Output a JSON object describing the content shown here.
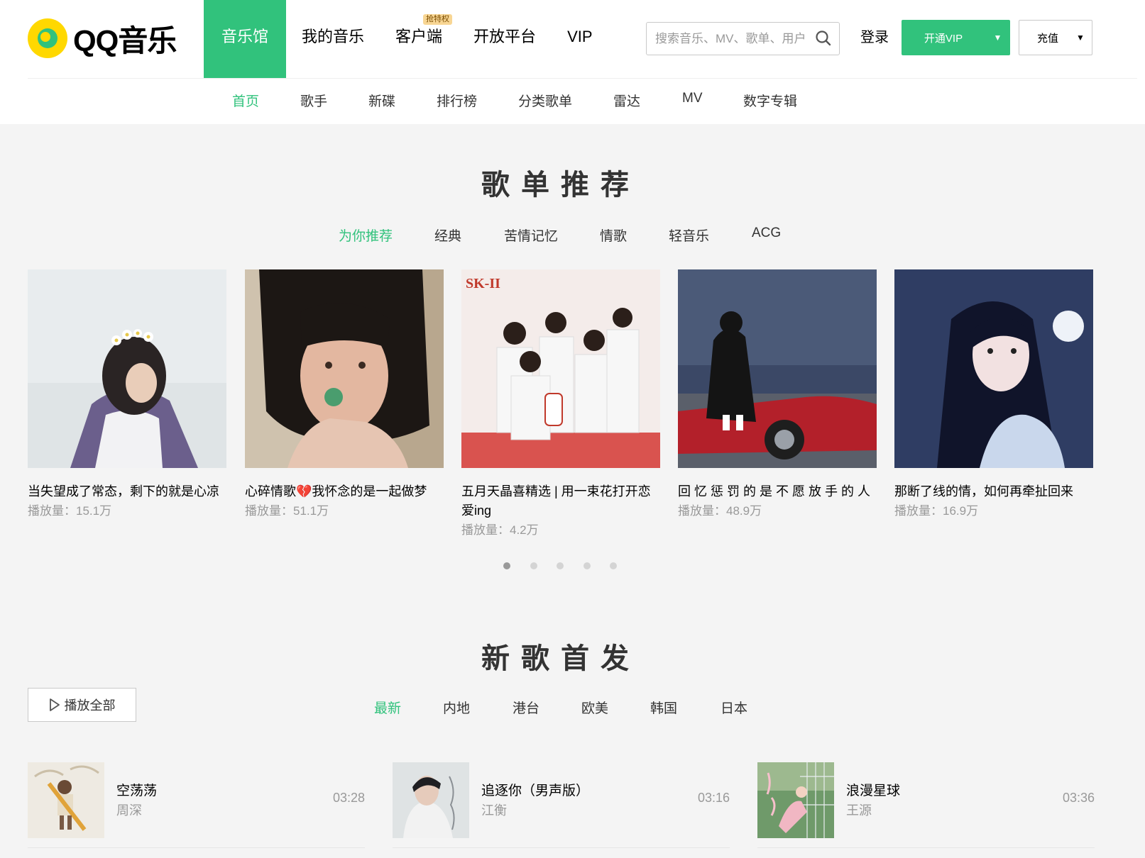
{
  "brand": {
    "logo_text": "QQ音乐",
    "accent_color": "#31c27c",
    "logo_color": "#ffd800"
  },
  "topnav": {
    "items": [
      {
        "label": "音乐馆",
        "active": true
      },
      {
        "label": "我的音乐"
      },
      {
        "label": "客户端",
        "badge": "抢特权"
      },
      {
        "label": "开放平台"
      },
      {
        "label": "VIP"
      }
    ]
  },
  "search": {
    "placeholder": "搜索音乐、MV、歌单、用户"
  },
  "account": {
    "login": "登录",
    "vip": "开通VIP",
    "recharge": "充值"
  },
  "subnav": {
    "items": [
      {
        "label": "首页",
        "active": true
      },
      {
        "label": "歌手"
      },
      {
        "label": "新碟"
      },
      {
        "label": "排行榜"
      },
      {
        "label": "分类歌单"
      },
      {
        "label": "雷达"
      },
      {
        "label": "MV"
      },
      {
        "label": "数字专辑"
      }
    ]
  },
  "playlists": {
    "title": "歌单推荐",
    "tabs": [
      {
        "label": "为你推荐",
        "active": true
      },
      {
        "label": "经典"
      },
      {
        "label": "苦情记忆"
      },
      {
        "label": "情歌"
      },
      {
        "label": "轻音乐"
      },
      {
        "label": "ACG"
      }
    ],
    "cards": [
      {
        "title": "当失望成了常态，剩下的就是心凉",
        "plays": "播放量：15.1万"
      },
      {
        "title": "心碎情歌💔我怀念的是一起做梦",
        "plays": "播放量：51.1万"
      },
      {
        "title": "五月天晶喜精选 | 用一束花打开恋爱ing",
        "plays": "播放量：4.2万"
      },
      {
        "title": "回 忆 惩 罚 的 是 不 愿 放 手 的 人",
        "plays": "播放量：48.9万"
      },
      {
        "title": "那断了线的情，如何再牵扯回来",
        "plays": "播放量：16.9万"
      }
    ],
    "pages": 5,
    "current_page": 1
  },
  "new_songs": {
    "title": "新歌首发",
    "play_all": "播放全部",
    "tabs": [
      {
        "label": "最新",
        "active": true
      },
      {
        "label": "内地"
      },
      {
        "label": "港台"
      },
      {
        "label": "欧美"
      },
      {
        "label": "韩国"
      },
      {
        "label": "日本"
      }
    ],
    "songs": [
      {
        "name": "空荡荡",
        "artist": "周深",
        "duration": "03:28"
      },
      {
        "name": "追逐你（男声版）",
        "artist": "江衡",
        "duration": "03:16"
      },
      {
        "name": "浪漫星球",
        "artist": "王源",
        "duration": "03:36"
      }
    ]
  }
}
